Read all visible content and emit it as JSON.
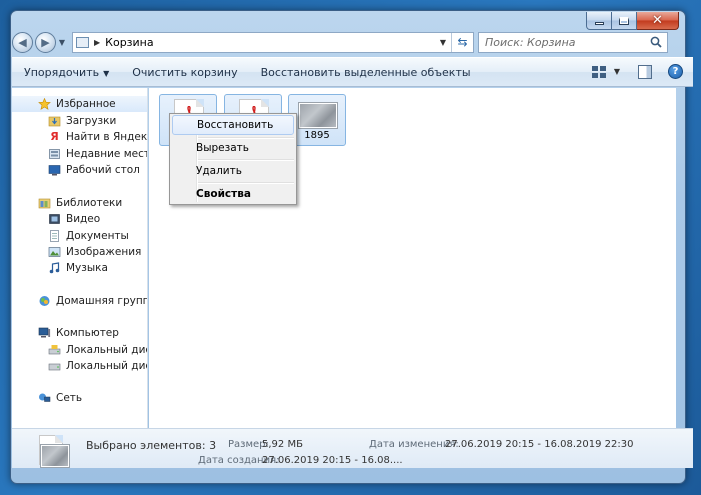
{
  "address": {
    "location": "Корзина",
    "search_placeholder": "Поиск: Корзина"
  },
  "toolbar": {
    "organize": "Упорядочить",
    "empty": "Очистить корзину",
    "restore_selected": "Восстановить выделенные объекты"
  },
  "sidebar": {
    "favorites": "Избранное",
    "downloads": "Загрузки",
    "yandex": "Найти в Яндексе",
    "recent": "Недавние места",
    "desktop": "Рабочий стол",
    "libraries": "Библиотеки",
    "video": "Видео",
    "documents": "Документы",
    "images": "Изображения",
    "music": "Музыка",
    "homegroup": "Домашняя группа",
    "computer": "Компьютер",
    "disk_c": "Локальный диск (C:)",
    "disk_d": "Локальный диск (D:)",
    "network": "Сеть"
  },
  "files": [
    {
      "label": ""
    },
    {
      "label": ""
    },
    {
      "label": "1895"
    }
  ],
  "context_menu": {
    "restore": "Восстановить",
    "cut": "Вырезать",
    "delete": "Удалить",
    "properties": "Свойства"
  },
  "details": {
    "selected": "Выбрано элементов: 3",
    "size_label": "Размер:",
    "size_value": "5,92 МБ",
    "modified_label": "Дата изменения:",
    "modified_value": "27.06.2019 20:15 - 16.08.2019 22:30",
    "created_label": "Дата создания:",
    "created_value": "27.06.2019 20:15 - 16.08...."
  }
}
